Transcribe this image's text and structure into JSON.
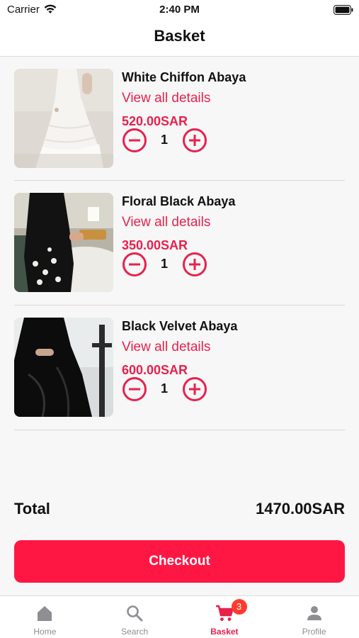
{
  "status_bar": {
    "carrier": "Carrier",
    "time": "2:40 PM"
  },
  "header": {
    "title": "Basket"
  },
  "items": [
    {
      "name": "White Chiffon Abaya",
      "details_link": "View all details",
      "price": "520.00SAR",
      "quantity": "1",
      "image_icon": "white-abaya-photo"
    },
    {
      "name": "Floral Black Abaya",
      "details_link": "View all details",
      "price": "350.00SAR",
      "quantity": "1",
      "image_icon": "floral-black-abaya-photo"
    },
    {
      "name": "Black Velvet Abaya",
      "details_link": "View all details",
      "price": "600.00SAR",
      "quantity": "1",
      "image_icon": "black-velvet-abaya-photo"
    }
  ],
  "summary": {
    "total_label": "Total",
    "total_value": "1470.00SAR",
    "checkout_label": "Checkout"
  },
  "tabbar": {
    "tabs": [
      {
        "label": "Home",
        "icon": "home-icon"
      },
      {
        "label": "Search",
        "icon": "search-icon"
      },
      {
        "label": "Basket",
        "icon": "cart-icon",
        "badge": "3",
        "active": true
      },
      {
        "label": "Profile",
        "icon": "person-icon"
      }
    ]
  },
  "colors": {
    "accent": "#e8214c",
    "button": "#ff1744",
    "badge": "#ff3b30",
    "inactive_tab": "#8e8e93",
    "background": "#f7f7f7"
  }
}
